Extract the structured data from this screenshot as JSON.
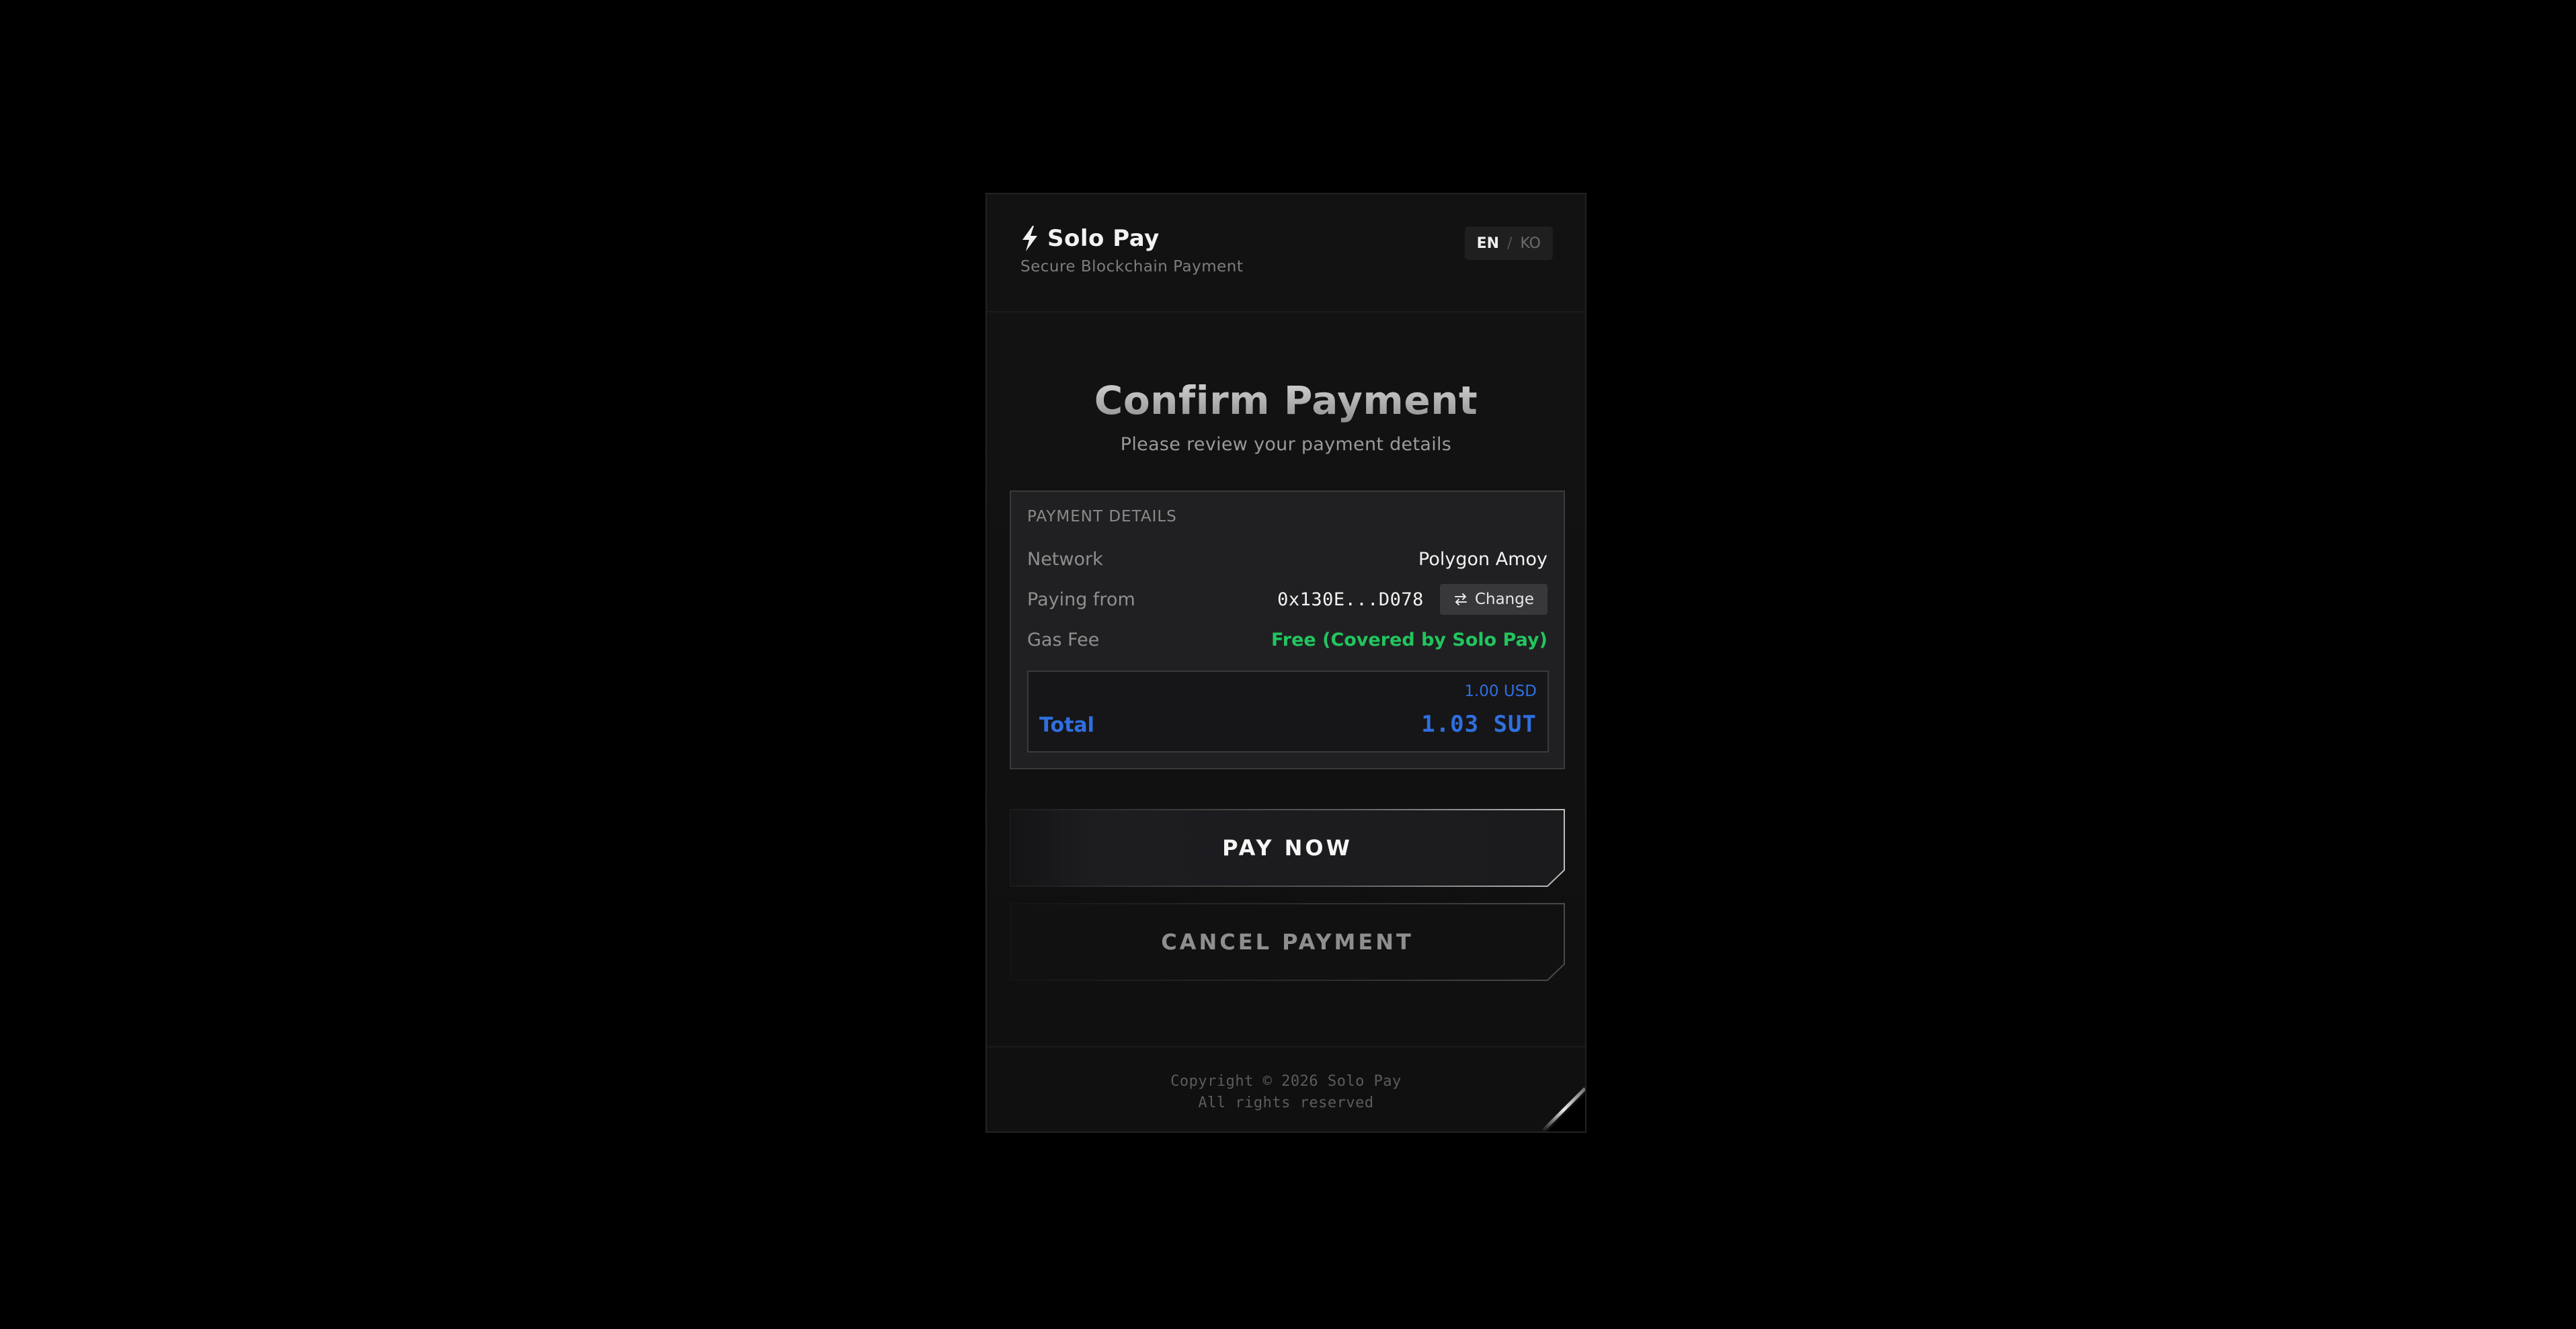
{
  "brand": {
    "name": "Solo Pay",
    "tagline": "Secure Blockchain Payment"
  },
  "language": {
    "active": "EN",
    "separator": "/",
    "other": "KO"
  },
  "page": {
    "title": "Confirm Payment",
    "subtitle": "Please review your payment details"
  },
  "details": {
    "heading": "PAYMENT DETAILS",
    "network_label": "Network",
    "network_value": "Polygon Amoy",
    "paying_from_label": "Paying from",
    "wallet_address": "0x130E...D078",
    "change_label": "Change",
    "gas_fee_label": "Gas Fee",
    "gas_fee_value": "Free (Covered by Solo Pay)",
    "usd_amount": "1.00 USD",
    "total_label": "Total",
    "total_amount": "1.03 SUT"
  },
  "actions": {
    "pay_label": "PAY NOW",
    "cancel_label": "CANCEL PAYMENT"
  },
  "footer": {
    "copyright": "Copyright © 2026 Solo Pay",
    "rights": "All rights reserved"
  },
  "colors": {
    "accent_blue": "#2f6fe0",
    "success_green": "#22c55e",
    "background": "#000000",
    "card": "#121212"
  },
  "icons": {
    "brand": "lightning-bolt-icon",
    "change": "swap-arrows-icon"
  }
}
